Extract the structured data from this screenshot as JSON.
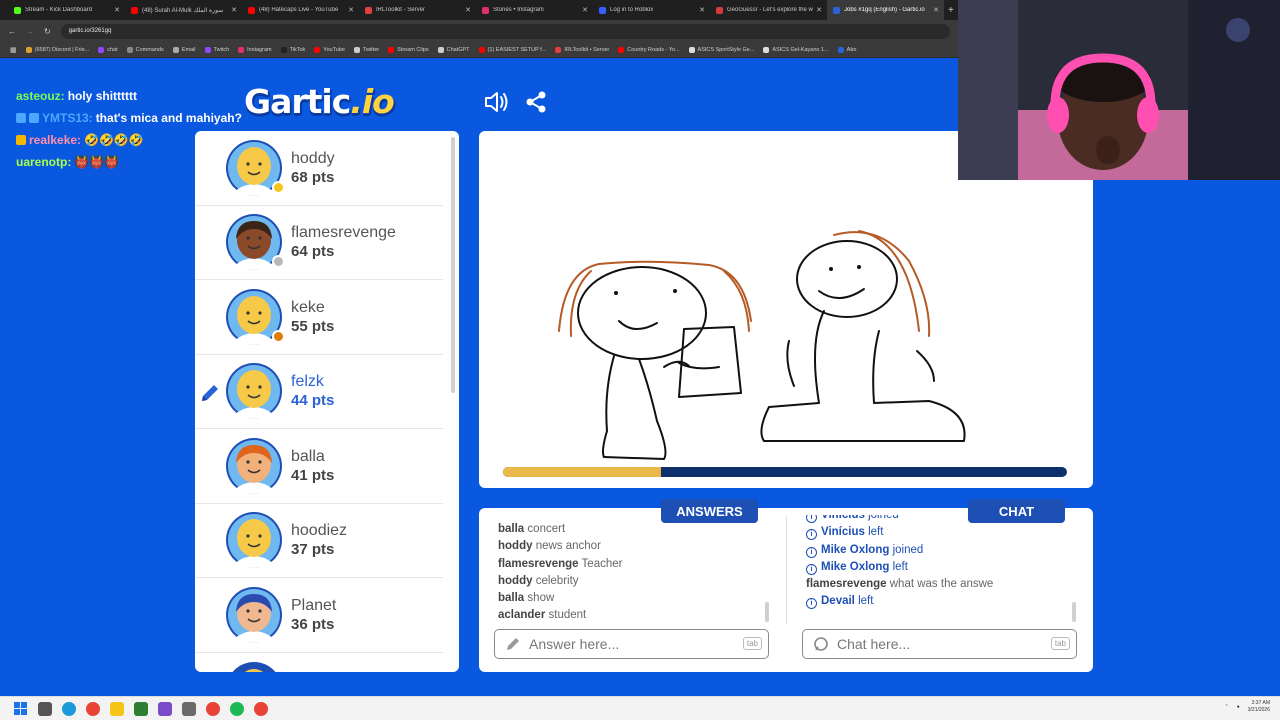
{
  "browser": {
    "tabs": [
      {
        "label": "Stream - Kick Dashboard",
        "color": "#53fc18",
        "active": false
      },
      {
        "label": "(48) Surah Al-Mulk سورة الملك",
        "color": "#ff0000",
        "active": false
      },
      {
        "label": "(48) Hatecaps Live - YouTube",
        "color": "#ff0000",
        "active": false
      },
      {
        "label": "IRLToolkit - Server",
        "color": "#e04040",
        "active": false
      },
      {
        "label": "Stories • Instagram",
        "color": "#e1306c",
        "active": false
      },
      {
        "label": "Log in to Roblox",
        "color": "#335fff",
        "active": false
      },
      {
        "label": "GeoGuessr - Let's explore the w",
        "color": "#d43a3a",
        "active": false
      },
      {
        "label": "Jobs #1gq (English) - Gartic.io",
        "color": "#2a63d8",
        "active": true
      }
    ],
    "url": "gartic.io/3261gq",
    "bookmarks": [
      {
        "label": "(6587) Discord | Frie...",
        "color": "#e0a030"
      },
      {
        "label": "chat",
        "color": "#9146ff"
      },
      {
        "label": "Commands",
        "color": "#888888"
      },
      {
        "label": "Email",
        "color": "#aaaaaa"
      },
      {
        "label": "Twitch",
        "color": "#9146ff"
      },
      {
        "label": "Instagram",
        "color": "#e1306c"
      },
      {
        "label": "TikTok",
        "color": "#222222"
      },
      {
        "label": "YouTube",
        "color": "#ff0000"
      },
      {
        "label": "Twitter",
        "color": "#cccccc"
      },
      {
        "label": "Stream Clips",
        "color": "#ff0000"
      },
      {
        "label": "ChatGPT",
        "color": "#cccccc"
      },
      {
        "label": "(1) EASIEST SETUP f...",
        "color": "#ff0000"
      },
      {
        "label": "IRLToolkit • Server",
        "color": "#e04040"
      },
      {
        "label": "Country Roads - Yo...",
        "color": "#ff0000"
      },
      {
        "label": "ASICS SportStyle Ge...",
        "color": "#dddddd"
      },
      {
        "label": "ASICS Gel-Kayano 1...",
        "color": "#dddddd"
      },
      {
        "label": "Abo",
        "color": "#2a63d8"
      }
    ]
  },
  "stream_chat": [
    {
      "user": "asteouz",
      "user_color": "#7cfc55",
      "message": "holy shitttttt",
      "badges": []
    },
    {
      "user": "YMTS13",
      "user_color": "#4aa8ff",
      "message": "that's mica and mahiyah?",
      "badges": [
        "#4aa8ff",
        "#4aa8ff"
      ]
    },
    {
      "user": "realkeke",
      "user_color": "#ff8fa8",
      "message": "🤣🤣🤣🤣",
      "badges": [
        "#f5b800"
      ]
    },
    {
      "user": "uarenotp",
      "user_color": "#a8ff4a",
      "message": "👹👹👹",
      "badges": []
    }
  ],
  "logo": {
    "main": "Gartic",
    "suffix": ".io"
  },
  "players": [
    {
      "name": "hoddy",
      "points": "68 pts",
      "skin": "#f7c948",
      "hair": "none",
      "status": "#f5c518",
      "drawing": false
    },
    {
      "name": "flamesrevenge",
      "points": "64 pts",
      "skin": "#8a4a2a",
      "hair": "#3a2418",
      "status": "#b8b8b8",
      "drawing": false
    },
    {
      "name": "keke",
      "points": "55 pts",
      "skin": "#f7c948",
      "hair": "none",
      "status": "#e07b00",
      "drawing": false
    },
    {
      "name": "felzk",
      "points": "44 pts",
      "skin": "#f7c948",
      "hair": "none",
      "status": "",
      "drawing": true
    },
    {
      "name": "balla",
      "points": "41 pts",
      "skin": "#f2b07a",
      "hair": "#e0651c",
      "status": "",
      "drawing": false
    },
    {
      "name": "hoodiez",
      "points": "37 pts",
      "skin": "#f7c948",
      "hair": "none",
      "status": "",
      "drawing": false
    },
    {
      "name": "Planet",
      "points": "36 pts",
      "skin": "#f0b890",
      "hair": "#2a4ab0",
      "status": "",
      "drawing": false
    }
  ],
  "round_progress": 0.28,
  "answers": {
    "tab_label": "ANSWERS",
    "messages": [
      {
        "user": "balla",
        "text": "concert"
      },
      {
        "user": "hoddy",
        "text": "news anchor"
      },
      {
        "user": "flamesrevenge",
        "text": "Teacher"
      },
      {
        "user": "hoddy",
        "text": "celebrity"
      },
      {
        "user": "balla",
        "text": "show"
      },
      {
        "user": "aclander",
        "text": "student"
      }
    ],
    "placeholder": "Answer here...",
    "key_hint": "tab"
  },
  "chat": {
    "tab_label": "CHAT",
    "messages": [
      {
        "type": "system",
        "user": "Vinícius",
        "text": "joined"
      },
      {
        "type": "system",
        "user": "Vinícius",
        "text": "left"
      },
      {
        "type": "system",
        "user": "Mike Oxlong",
        "text": "joined"
      },
      {
        "type": "system",
        "user": "Mike Oxlong",
        "text": "left"
      },
      {
        "type": "user",
        "user": "flamesrevenge",
        "text": "what was the answe"
      },
      {
        "type": "system",
        "user": "Devail",
        "text": "left"
      }
    ],
    "placeholder": "Chat here...",
    "key_hint": "tab"
  },
  "taskbar": {
    "time": "2:37 AM",
    "date": "3/21/2026"
  }
}
